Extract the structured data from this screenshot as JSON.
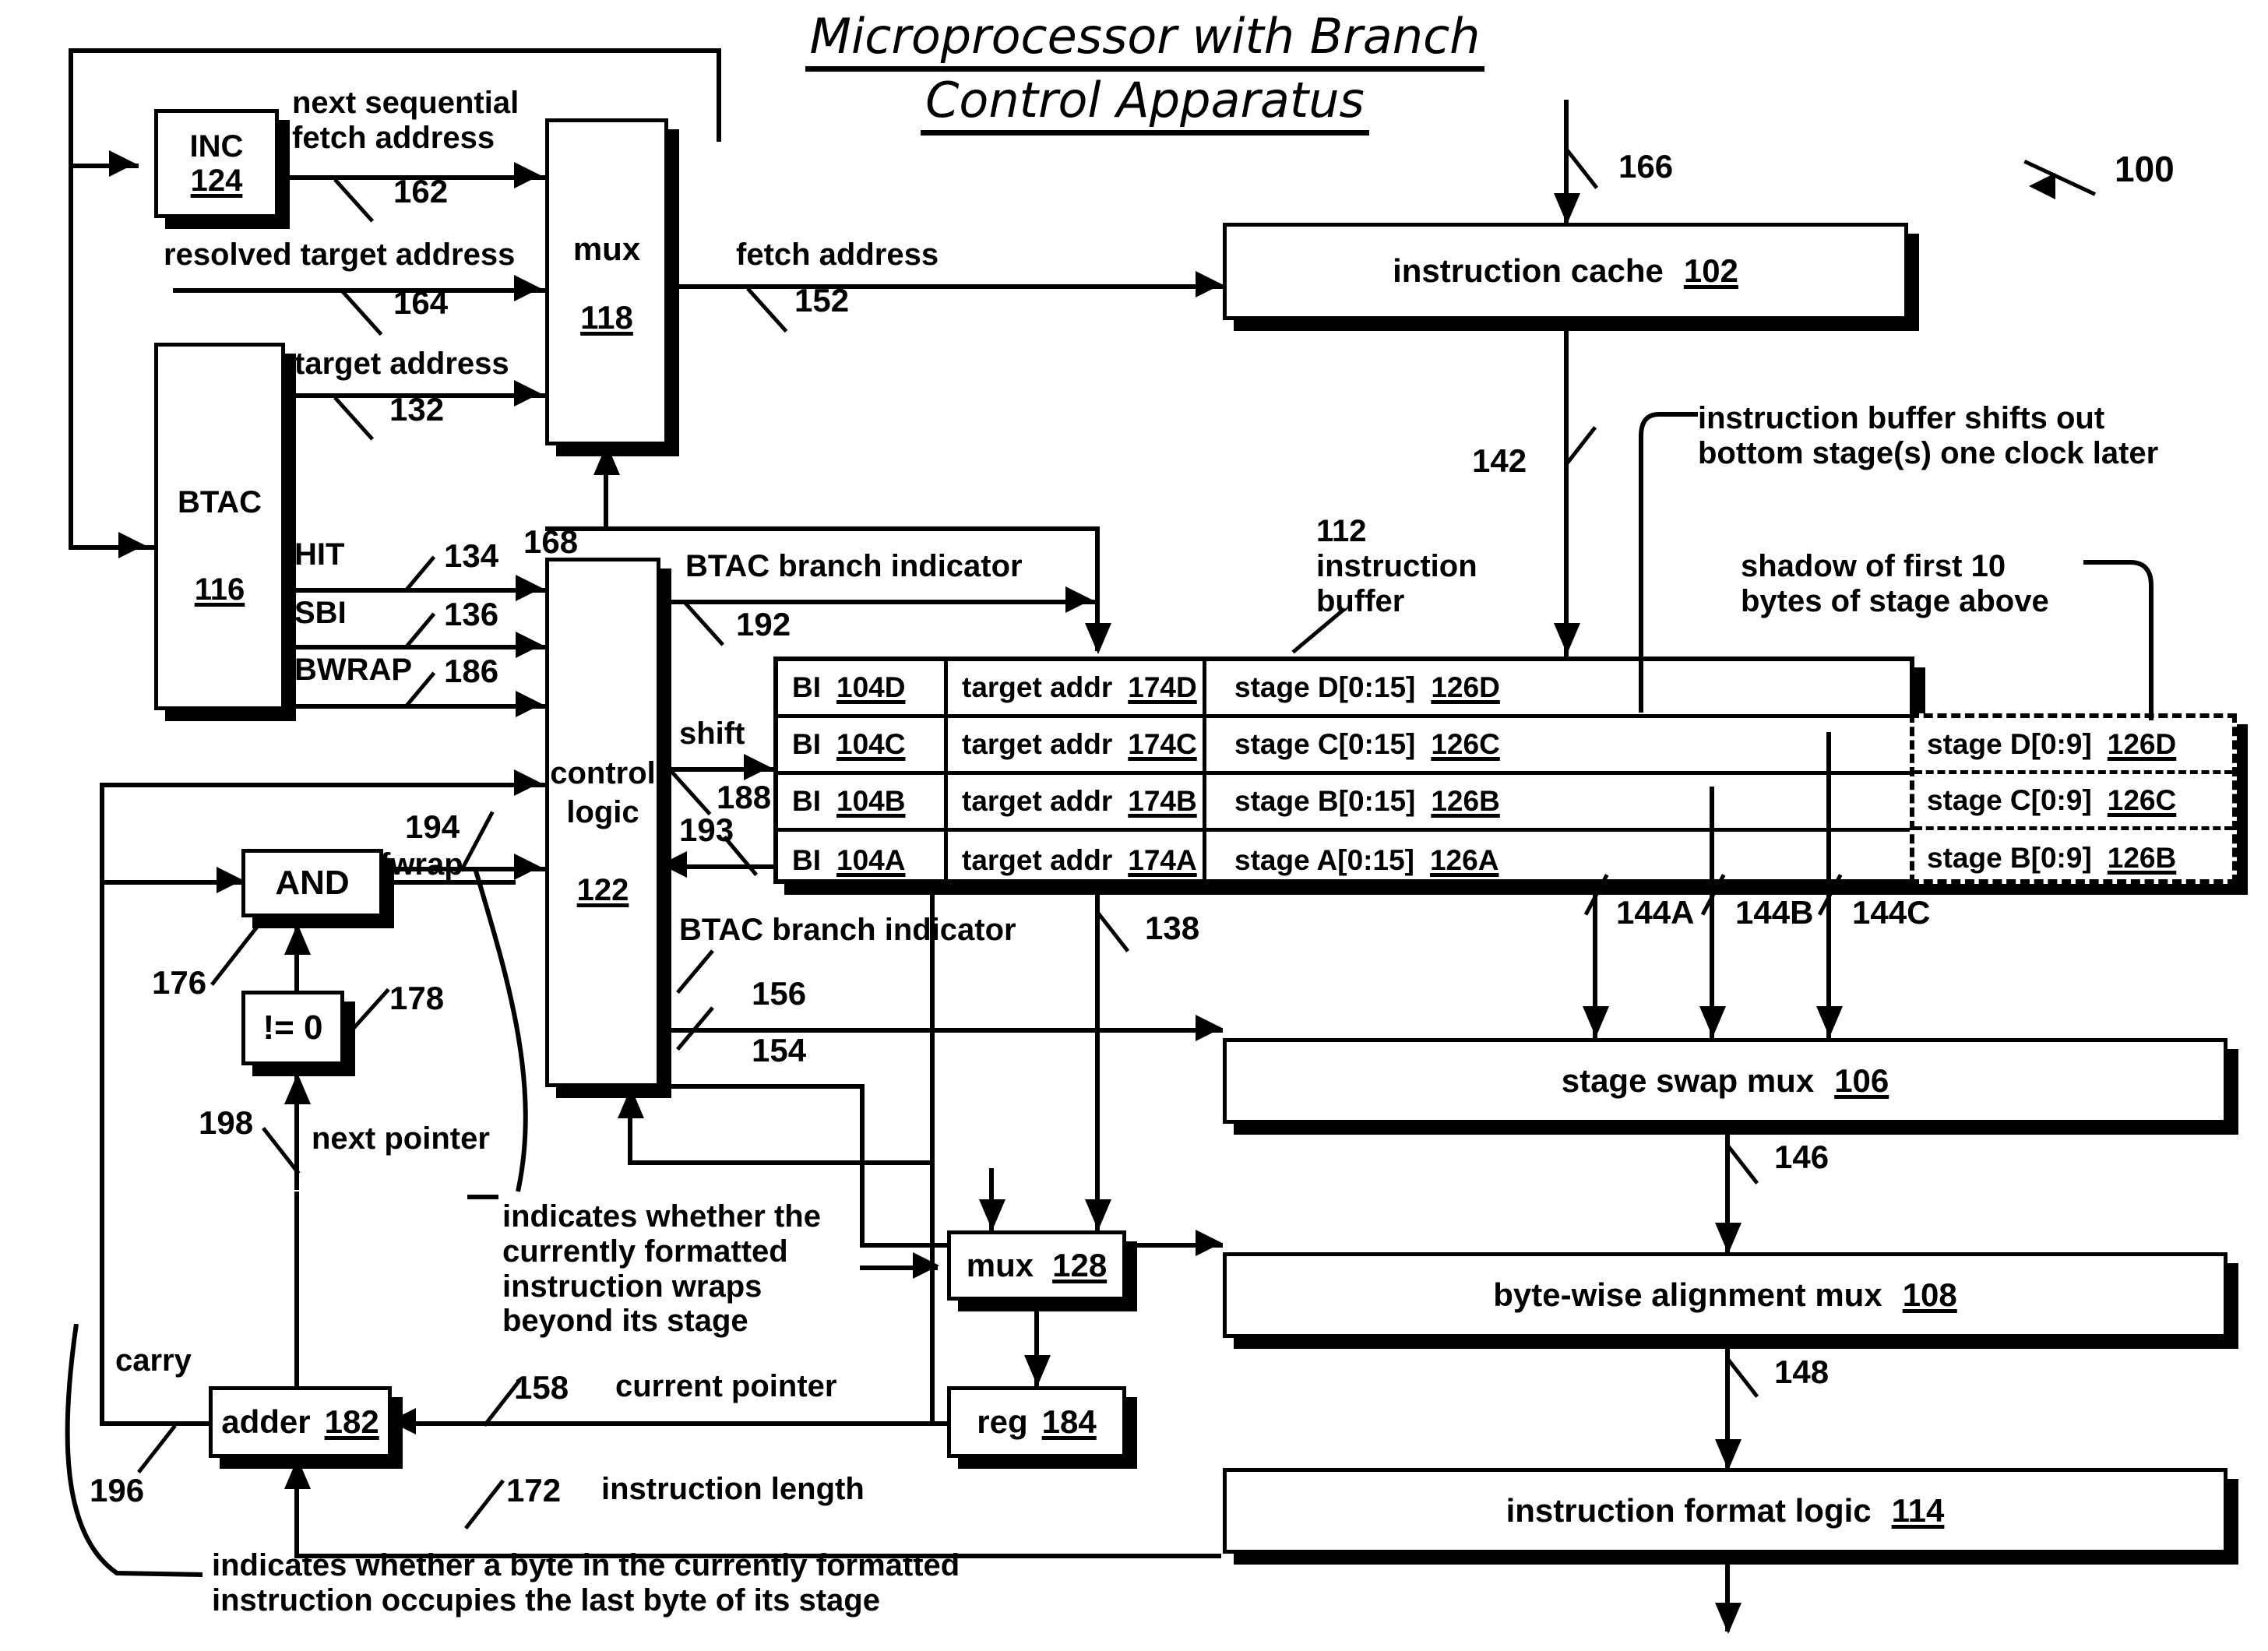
{
  "title": {
    "line1": "Microprocessor with Branch",
    "line2": "Control Apparatus"
  },
  "figure_ref": "100",
  "blocks": {
    "inc": {
      "label": "INC",
      "ref": "124"
    },
    "btac": {
      "label": "BTAC",
      "ref": "116"
    },
    "mux118": {
      "label": "mux",
      "ref": "118"
    },
    "control_logic": {
      "label1": "control",
      "label2": "logic",
      "ref": "122"
    },
    "and": {
      "label": "AND"
    },
    "neq0": {
      "label": "!= 0"
    },
    "adder": {
      "label": "adder",
      "ref": "182"
    },
    "mux128": {
      "label": "mux",
      "ref": "128"
    },
    "reg184": {
      "label": "reg",
      "ref": "184"
    },
    "icache": {
      "label": "instruction cache",
      "ref": "102"
    },
    "stage_swap_mux": {
      "label": "stage swap mux",
      "ref": "106"
    },
    "alignment_mux": {
      "label": "byte-wise alignment mux",
      "ref": "108"
    },
    "format_logic": {
      "label": "instruction format logic",
      "ref": "114"
    }
  },
  "signals": {
    "next_sequential_fetch_address": "next sequential\nfetch address",
    "next_seq_ref": "162",
    "resolved_target_address": "resolved target address",
    "resolved_ref": "164",
    "target_address": "target address",
    "target_ref": "132",
    "fetch_address": "fetch address",
    "fetch_ref": "152",
    "hit": "HIT",
    "hit_ref": "134",
    "sbi": "SBI",
    "sbi_ref": "136",
    "bwrap": "BWRAP",
    "bwrap_ref": "186",
    "ref_168": "168",
    "btac_branch_indicator_top": "BTAC branch indicator",
    "ref_192": "192",
    "shift": "shift",
    "ref_188": "188",
    "ref_193": "193",
    "btac_branch_indicator_bottom": "BTAC branch indicator",
    "ref_138": "138",
    "ref_166": "166",
    "ref_142": "142",
    "ref_156": "156",
    "ref_154": "154",
    "ref_176": "176",
    "ref_178": "178",
    "ref_198": "198",
    "ref_194": "194",
    "fwrap": "fwrap",
    "next_pointer": "next pointer",
    "carry": "carry",
    "ref_196": "196",
    "ref_158": "158",
    "current_pointer": "current pointer",
    "ref_172": "172",
    "instruction_length": "instruction length",
    "ref_144a": "144A",
    "ref_144b": "144B",
    "ref_144c": "144C",
    "ref_146": "146",
    "ref_148": "148"
  },
  "annotations": {
    "buffer_title": "112\ninstruction\nbuffer",
    "shift_out": "instruction buffer shifts out\nbottom stage(s) one clock later",
    "shadow": "shadow of first 10\nbytes of stage above",
    "wraps": "indicates whether the\ncurrently formatted\ninstruction wraps\nbeyond its stage",
    "last_byte": "indicates whether a byte in the currently formatted\ninstruction occupies the last byte of its stage"
  },
  "instruction_buffer": {
    "rows": [
      {
        "bi": "BI",
        "bi_ref": "104D",
        "ta": "target addr",
        "ta_ref": "174D",
        "stage": "stage D[0:15]",
        "stage_ref": "126D"
      },
      {
        "bi": "BI",
        "bi_ref": "104C",
        "ta": "target addr",
        "ta_ref": "174C",
        "stage": "stage C[0:15]",
        "stage_ref": "126C"
      },
      {
        "bi": "BI",
        "bi_ref": "104B",
        "ta": "target addr",
        "ta_ref": "174B",
        "stage": "stage B[0:15]",
        "stage_ref": "126B"
      },
      {
        "bi": "BI",
        "bi_ref": "104A",
        "ta": "target addr",
        "ta_ref": "174A",
        "stage": "stage A[0:15]",
        "stage_ref": "126A"
      }
    ]
  },
  "shadow_buffer": {
    "rows": [
      {
        "stage": "stage D[0:9]",
        "stage_ref": "126D"
      },
      {
        "stage": "stage C[0:9]",
        "stage_ref": "126C"
      },
      {
        "stage": "stage B[0:9]",
        "stage_ref": "126B"
      }
    ]
  }
}
